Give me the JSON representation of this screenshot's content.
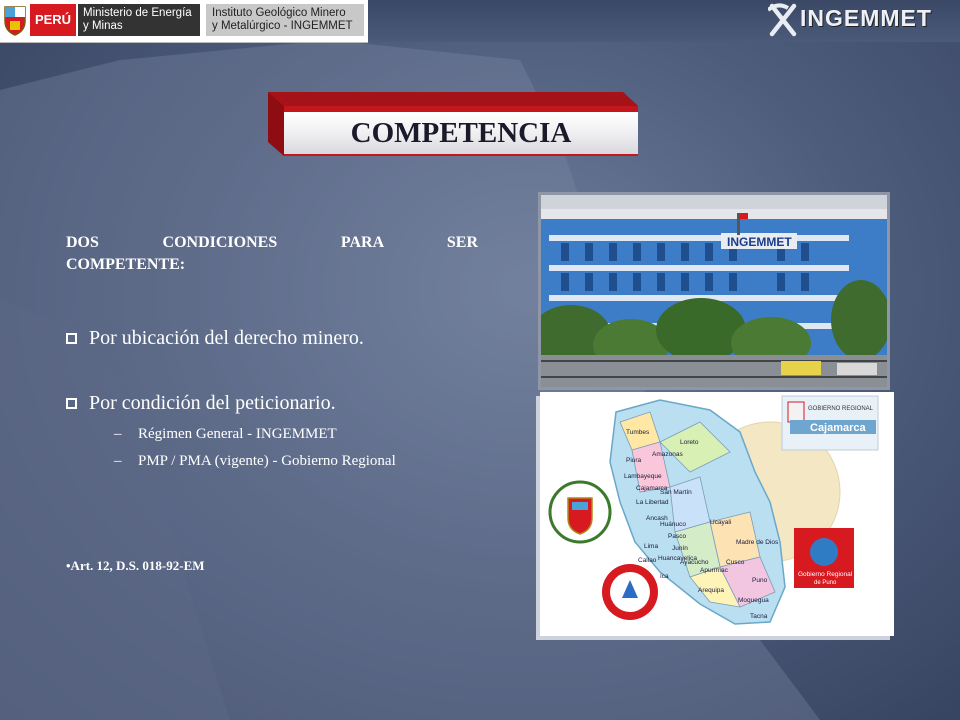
{
  "header": {
    "peru": "PERÚ",
    "ministry": "Ministerio de Energía y Minas",
    "institute_line1": "Instituto Geológico Minero",
    "institute_line2": "y Metalúrgico - INGEMMET",
    "brand": "INGEMMET"
  },
  "slide": {
    "title": "COMPETENCIA",
    "conditions_heading_line1": "DOS CONDICIONES PARA SER",
    "conditions_heading_line2": "COMPETENTE:",
    "bullets": [
      {
        "text": "Por ubicación del derecho minero."
      },
      {
        "text": "Por condición del peticionario.",
        "sub": [
          "Régimen General  -  INGEMMET",
          "PMP / PMA (vigente) - Gobierno Regional"
        ]
      }
    ],
    "reference": "•Art. 12, D.S. 018-92-EM"
  },
  "photo": {
    "building_sign": "INGEMMET"
  },
  "map_card": {
    "cajamarca_small": "GOBIERNO REGIONAL",
    "cajamarca": "Cajamarca",
    "puno_line1": "Gobierno Regional",
    "puno_line2": "de Puno",
    "la_libertad_seal": "GOBIERNO REGIONAL LA LIBERTAD",
    "regions": [
      "Tumbes",
      "Loreto",
      "Piura",
      "Amazonas",
      "Lambayeque",
      "Cajamarca",
      "San Martín",
      "La Libertad",
      "Ancash",
      "Huánuco",
      "Ucayali",
      "Pasco",
      "Lima",
      "Junín",
      "Madre de Dios",
      "Callao",
      "Cusco",
      "Ica",
      "Apurímac",
      "Puno",
      "Arequipa",
      "Moquegua",
      "Tacna",
      "Ayacucho",
      "Huancavelica"
    ]
  },
  "colors": {
    "banner_red": "#c4161c",
    "background": "#4e5d7c"
  }
}
